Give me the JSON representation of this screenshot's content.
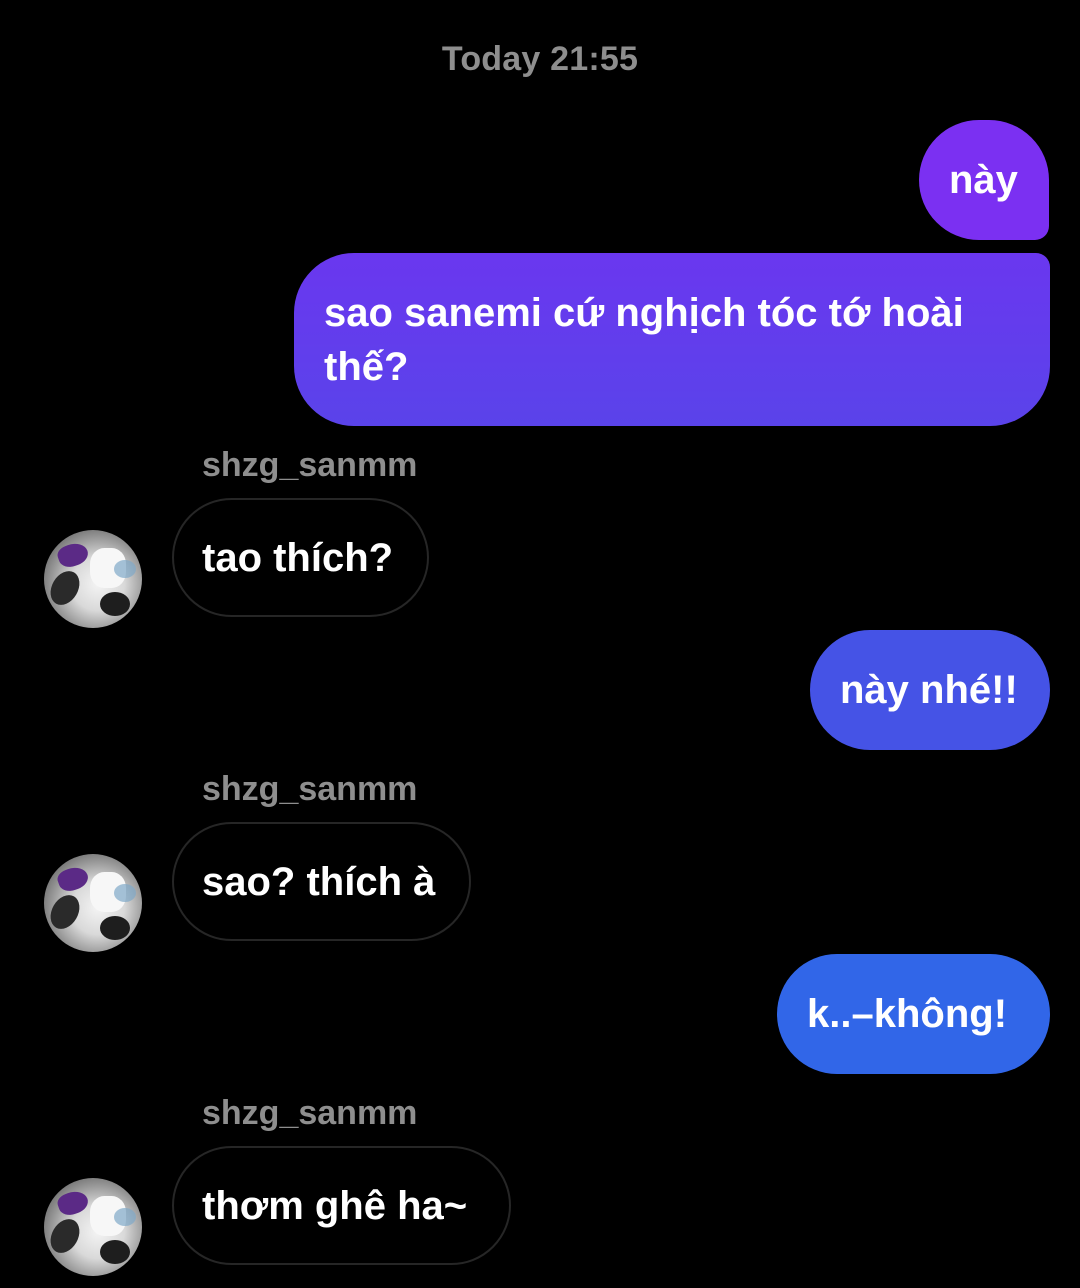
{
  "conversation": {
    "timestamp": "Today 21:55",
    "colors": {
      "background": "#000000",
      "outgoing_top": "#7b2ff7",
      "outgoing_mid": "#5b45ec",
      "outgoing_bottom": "#2f6fea",
      "incoming_border": "#262626",
      "meta_text": "#8e8e8e"
    },
    "messages": [
      {
        "direction": "outgoing",
        "text": "này"
      },
      {
        "direction": "outgoing",
        "text": "sao sanemi cứ nghịch tóc tớ hoài thế?"
      },
      {
        "direction": "incoming",
        "sender": "shzg_sanmm",
        "text": "tao thích?"
      },
      {
        "direction": "outgoing",
        "text": "này nhé!!"
      },
      {
        "direction": "incoming",
        "sender": "shzg_sanmm",
        "text": "sao? thích à"
      },
      {
        "direction": "outgoing",
        "text": "k..–không!"
      },
      {
        "direction": "incoming",
        "sender": "shzg_sanmm",
        "text": "thơm ghê ha~"
      }
    ]
  }
}
